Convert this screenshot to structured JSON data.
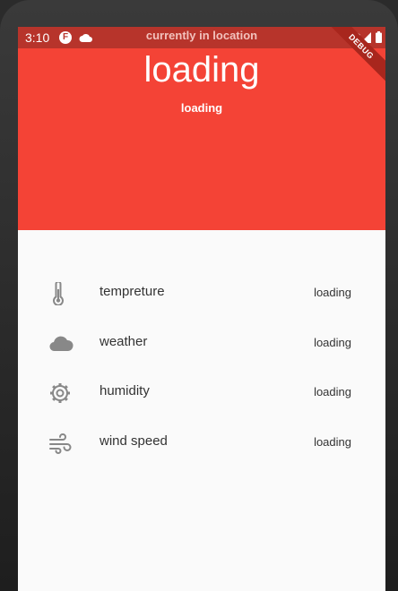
{
  "status_bar": {
    "time": "3:10",
    "title": "currently in location",
    "debug_label": "DEBUG"
  },
  "header": {
    "title": "loading",
    "subtitle": "loading"
  },
  "rows": [
    {
      "icon": "thermometer-icon",
      "label": "tempreture",
      "value": "loading"
    },
    {
      "icon": "cloud-icon",
      "label": "weather",
      "value": "loading"
    },
    {
      "icon": "gear-icon",
      "label": "humidity",
      "value": "loading"
    },
    {
      "icon": "wind-icon",
      "label": "wind speed",
      "value": "loading"
    }
  ],
  "colors": {
    "header": "#f44336",
    "status_bar": "#b7342b",
    "icon": "#888888"
  }
}
